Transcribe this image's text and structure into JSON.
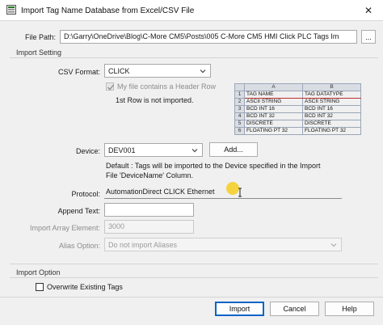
{
  "window": {
    "title": "Import Tag Name Database from Excel/CSV File",
    "close_glyph": "✕",
    "icon": "import-db-icon"
  },
  "file_path": {
    "label": "File Path:",
    "value": "D:\\Garry\\OneDrive\\Blog\\C-More CM5\\Posts\\005 C-More CM5 HMI Click PLC Tags Im",
    "browse_label": "..."
  },
  "import_setting": {
    "title": "Import Setting",
    "csv_format_label": "CSV Format:",
    "csv_format_value": "CLICK",
    "header_row_label": "My file contains a Header Row",
    "header_row_checked": true,
    "first_row_note": "1st Row is not imported.",
    "preview": {
      "columns": [
        "A",
        "B"
      ],
      "rows": [
        {
          "num": "1",
          "a": "TAG NAME",
          "b": "TAG DATATYPE"
        },
        {
          "num": "2",
          "a": "ASCII STRING",
          "b": "ASCII STRING"
        },
        {
          "num": "3",
          "a": "BCD INT 16",
          "b": "BCD INT 16"
        },
        {
          "num": "4",
          "a": "BCD INT 32",
          "b": "BCD INT 32"
        },
        {
          "num": "5",
          "a": "DISCRETE",
          "b": "DISCRETE"
        },
        {
          "num": "6",
          "a": "FLOATING PT 32",
          "b": "FLOATING PT 32"
        }
      ]
    },
    "device_label": "Device:",
    "device_value": "DEV001",
    "add_label": "Add...",
    "device_note_line1": "Default : Tags will be imported to the Device specified in the Import",
    "device_note_line2": "File 'DeviceName' Column.",
    "protocol_label": "Protocol:",
    "protocol_value": "AutomationDirect CLICK Ethernet",
    "append_text_label": "Append Text:",
    "append_text_value": "",
    "import_array_label": "Import Array Element:",
    "import_array_value": "3000",
    "alias_label": "Alias Option:",
    "alias_value": "Do not import Aliases"
  },
  "import_option": {
    "title": "Import Option",
    "overwrite_label": "Overwrite Existing Tags",
    "overwrite_checked": false
  },
  "buttons": {
    "import": "Import",
    "cancel": "Cancel",
    "help": "Help"
  },
  "colors": {
    "primary_border": "#0a64c8",
    "cursor_highlight": "#f4cf2a",
    "header_row_outline": "#c03030"
  }
}
